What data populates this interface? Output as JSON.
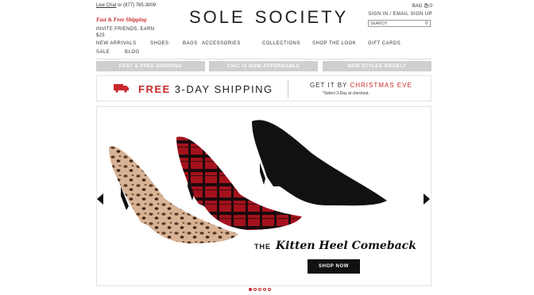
{
  "header": {
    "live_chat": "Live Chat",
    "phone": " or (877) 765-3009",
    "promo": "Fast & Free Shipping",
    "invite": "INVITE FRIENDS, EARN $25",
    "logo_left": "SOLE",
    "logo_right": "SOCIETY",
    "bag_label": "BAG",
    "bag_count": "0",
    "sign_in": "SIGN IN",
    "separator": "/",
    "email_signup": "EMAIL SIGN UP",
    "search_placeholder": "SEARCH"
  },
  "nav": {
    "row1": [
      "NEW ARRIVALS",
      "SHOES",
      "BAGS",
      "ACCESSORIES",
      "COLLECTIONS",
      "SHOP THE LOOK",
      "GIFT CARDS"
    ],
    "row2": [
      "SALE",
      "BLOG"
    ]
  },
  "bars": [
    "FAST & FREE SHIPPING",
    "CHIC IS NOW AFFORDABLE",
    "NEW STYLES WEEKLY"
  ],
  "shipping": {
    "free": "FREE",
    "rest": " 3-DAY SHIPPING",
    "get_it": "GET IT BY ",
    "christmas": "CHRISTMAS EVE",
    "note": "*Select 3-Day at checkout."
  },
  "hero": {
    "the": "THE",
    "headline": "Kitten Heel Comeback",
    "cta": "SHOP NOW",
    "slides": 5,
    "active_slide": 1
  },
  "colors": {
    "accent": "#c8282c",
    "bar": "#cfcfcf"
  }
}
